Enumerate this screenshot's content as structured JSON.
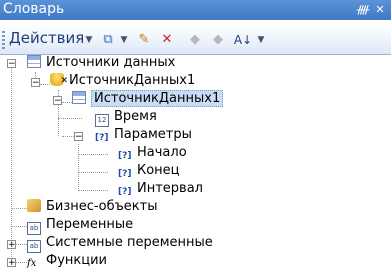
{
  "window": {
    "title": "Словарь",
    "pin_icon": "pin-icon",
    "close_icon": "close-icon"
  },
  "toolbar": {
    "actions_label": "Действия",
    "buttons": [
      "add-icon",
      "edit-icon",
      "delete-icon",
      "move-up-icon",
      "move-down-icon",
      "sort-icon"
    ]
  },
  "tree": {
    "data_sources": "Источники данных",
    "source_db": "ИсточникДанных1",
    "source_table": "ИсточникДанных1",
    "time": "Время",
    "parameters": "Параметры",
    "param_start": "Начало",
    "param_end": "Конец",
    "param_interval": "Интервал",
    "business_objects": "Бизнес-объекты",
    "variables": "Переменные",
    "system_variables": "Системные переменные",
    "functions": "Функции"
  },
  "colors": {
    "title_bar": "#4a86d0",
    "selection": "#c9dcf5"
  }
}
